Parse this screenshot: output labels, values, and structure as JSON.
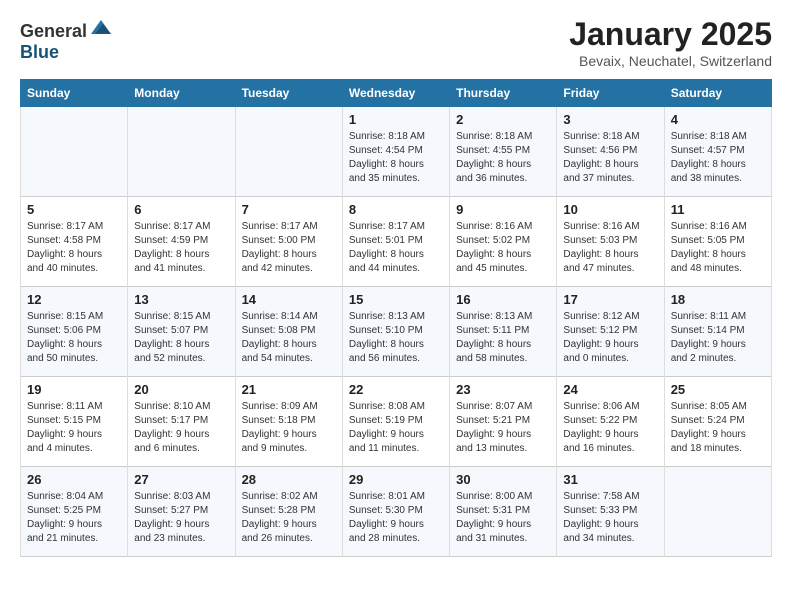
{
  "header": {
    "logo_general": "General",
    "logo_blue": "Blue",
    "title": "January 2025",
    "subtitle": "Bevaix, Neuchatel, Switzerland"
  },
  "days_of_week": [
    "Sunday",
    "Monday",
    "Tuesday",
    "Wednesday",
    "Thursday",
    "Friday",
    "Saturday"
  ],
  "weeks": [
    [
      {
        "day": "",
        "info": ""
      },
      {
        "day": "",
        "info": ""
      },
      {
        "day": "",
        "info": ""
      },
      {
        "day": "1",
        "info": "Sunrise: 8:18 AM\nSunset: 4:54 PM\nDaylight: 8 hours\nand 35 minutes."
      },
      {
        "day": "2",
        "info": "Sunrise: 8:18 AM\nSunset: 4:55 PM\nDaylight: 8 hours\nand 36 minutes."
      },
      {
        "day": "3",
        "info": "Sunrise: 8:18 AM\nSunset: 4:56 PM\nDaylight: 8 hours\nand 37 minutes."
      },
      {
        "day": "4",
        "info": "Sunrise: 8:18 AM\nSunset: 4:57 PM\nDaylight: 8 hours\nand 38 minutes."
      }
    ],
    [
      {
        "day": "5",
        "info": "Sunrise: 8:17 AM\nSunset: 4:58 PM\nDaylight: 8 hours\nand 40 minutes."
      },
      {
        "day": "6",
        "info": "Sunrise: 8:17 AM\nSunset: 4:59 PM\nDaylight: 8 hours\nand 41 minutes."
      },
      {
        "day": "7",
        "info": "Sunrise: 8:17 AM\nSunset: 5:00 PM\nDaylight: 8 hours\nand 42 minutes."
      },
      {
        "day": "8",
        "info": "Sunrise: 8:17 AM\nSunset: 5:01 PM\nDaylight: 8 hours\nand 44 minutes."
      },
      {
        "day": "9",
        "info": "Sunrise: 8:16 AM\nSunset: 5:02 PM\nDaylight: 8 hours\nand 45 minutes."
      },
      {
        "day": "10",
        "info": "Sunrise: 8:16 AM\nSunset: 5:03 PM\nDaylight: 8 hours\nand 47 minutes."
      },
      {
        "day": "11",
        "info": "Sunrise: 8:16 AM\nSunset: 5:05 PM\nDaylight: 8 hours\nand 48 minutes."
      }
    ],
    [
      {
        "day": "12",
        "info": "Sunrise: 8:15 AM\nSunset: 5:06 PM\nDaylight: 8 hours\nand 50 minutes."
      },
      {
        "day": "13",
        "info": "Sunrise: 8:15 AM\nSunset: 5:07 PM\nDaylight: 8 hours\nand 52 minutes."
      },
      {
        "day": "14",
        "info": "Sunrise: 8:14 AM\nSunset: 5:08 PM\nDaylight: 8 hours\nand 54 minutes."
      },
      {
        "day": "15",
        "info": "Sunrise: 8:13 AM\nSunset: 5:10 PM\nDaylight: 8 hours\nand 56 minutes."
      },
      {
        "day": "16",
        "info": "Sunrise: 8:13 AM\nSunset: 5:11 PM\nDaylight: 8 hours\nand 58 minutes."
      },
      {
        "day": "17",
        "info": "Sunrise: 8:12 AM\nSunset: 5:12 PM\nDaylight: 9 hours\nand 0 minutes."
      },
      {
        "day": "18",
        "info": "Sunrise: 8:11 AM\nSunset: 5:14 PM\nDaylight: 9 hours\nand 2 minutes."
      }
    ],
    [
      {
        "day": "19",
        "info": "Sunrise: 8:11 AM\nSunset: 5:15 PM\nDaylight: 9 hours\nand 4 minutes."
      },
      {
        "day": "20",
        "info": "Sunrise: 8:10 AM\nSunset: 5:17 PM\nDaylight: 9 hours\nand 6 minutes."
      },
      {
        "day": "21",
        "info": "Sunrise: 8:09 AM\nSunset: 5:18 PM\nDaylight: 9 hours\nand 9 minutes."
      },
      {
        "day": "22",
        "info": "Sunrise: 8:08 AM\nSunset: 5:19 PM\nDaylight: 9 hours\nand 11 minutes."
      },
      {
        "day": "23",
        "info": "Sunrise: 8:07 AM\nSunset: 5:21 PM\nDaylight: 9 hours\nand 13 minutes."
      },
      {
        "day": "24",
        "info": "Sunrise: 8:06 AM\nSunset: 5:22 PM\nDaylight: 9 hours\nand 16 minutes."
      },
      {
        "day": "25",
        "info": "Sunrise: 8:05 AM\nSunset: 5:24 PM\nDaylight: 9 hours\nand 18 minutes."
      }
    ],
    [
      {
        "day": "26",
        "info": "Sunrise: 8:04 AM\nSunset: 5:25 PM\nDaylight: 9 hours\nand 21 minutes."
      },
      {
        "day": "27",
        "info": "Sunrise: 8:03 AM\nSunset: 5:27 PM\nDaylight: 9 hours\nand 23 minutes."
      },
      {
        "day": "28",
        "info": "Sunrise: 8:02 AM\nSunset: 5:28 PM\nDaylight: 9 hours\nand 26 minutes."
      },
      {
        "day": "29",
        "info": "Sunrise: 8:01 AM\nSunset: 5:30 PM\nDaylight: 9 hours\nand 28 minutes."
      },
      {
        "day": "30",
        "info": "Sunrise: 8:00 AM\nSunset: 5:31 PM\nDaylight: 9 hours\nand 31 minutes."
      },
      {
        "day": "31",
        "info": "Sunrise: 7:58 AM\nSunset: 5:33 PM\nDaylight: 9 hours\nand 34 minutes."
      },
      {
        "day": "",
        "info": ""
      }
    ]
  ]
}
